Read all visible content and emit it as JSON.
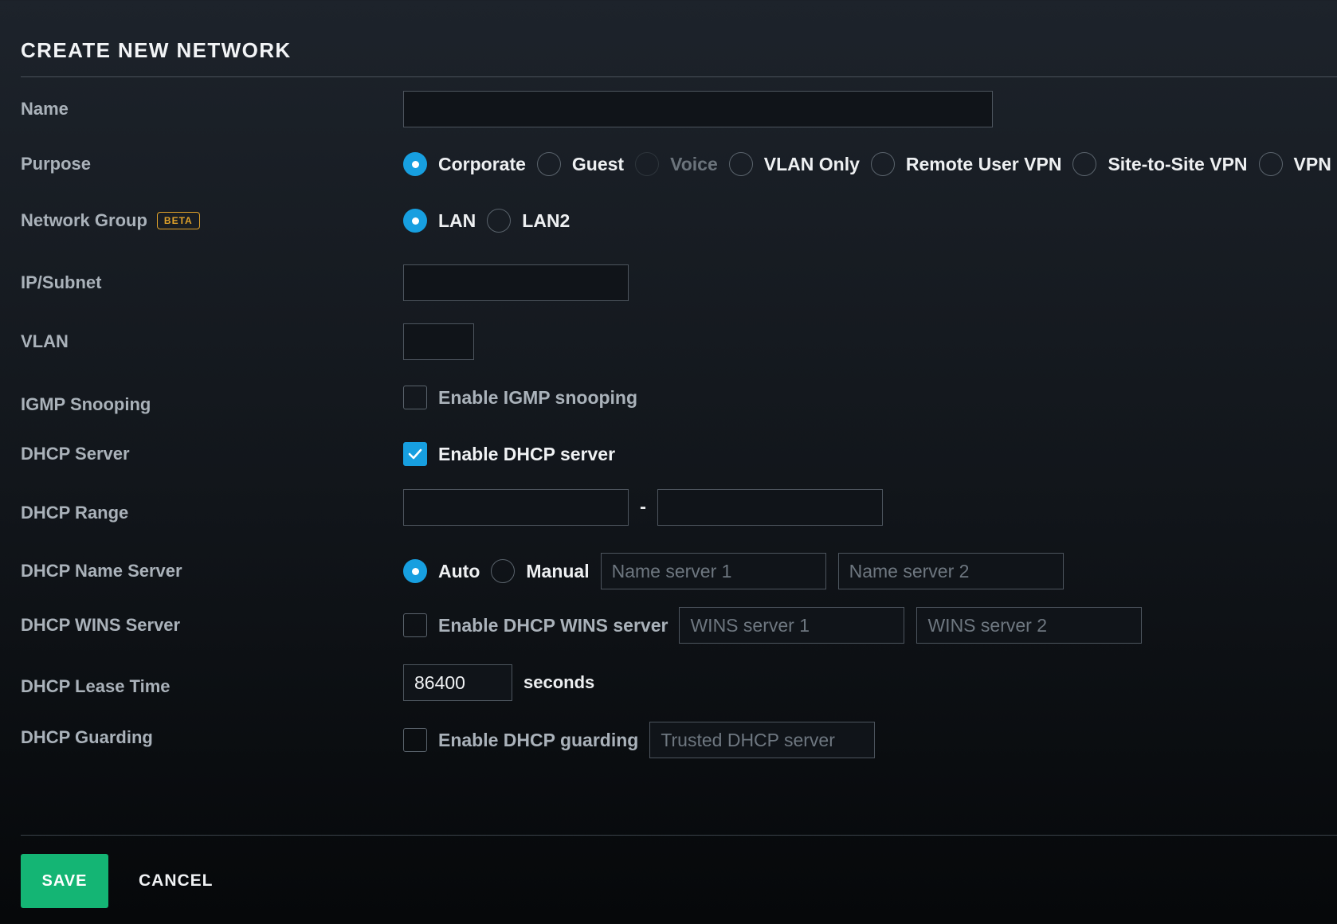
{
  "dialog": {
    "title": "CREATE NEW NETWORK"
  },
  "colors": {
    "accent_blue": "#179fe0",
    "save_green": "#14b574",
    "beta_orange": "#e0a22a"
  },
  "fields": {
    "name": {
      "label": "Name",
      "value": "",
      "placeholder": ""
    },
    "purpose": {
      "label": "Purpose",
      "options": [
        {
          "label": "Corporate",
          "selected": true,
          "disabled": false
        },
        {
          "label": "Guest",
          "selected": false,
          "disabled": false
        },
        {
          "label": "Voice",
          "selected": false,
          "disabled": true
        },
        {
          "label": "VLAN Only",
          "selected": false,
          "disabled": false
        },
        {
          "label": "Remote User VPN",
          "selected": false,
          "disabled": false
        },
        {
          "label": "Site-to-Site VPN",
          "selected": false,
          "disabled": false
        },
        {
          "label": "VPN Client",
          "selected": false,
          "disabled": false
        }
      ]
    },
    "network_group": {
      "label": "Network Group",
      "badge": "BETA",
      "options": [
        {
          "label": "LAN",
          "selected": true
        },
        {
          "label": "LAN2",
          "selected": false
        }
      ]
    },
    "ip_subnet": {
      "label": "IP/Subnet",
      "value": ""
    },
    "vlan": {
      "label": "VLAN",
      "value": ""
    },
    "igmp": {
      "label": "IGMP Snooping",
      "checkbox_label": "Enable IGMP snooping",
      "checked": false
    },
    "dhcp_server": {
      "label": "DHCP Server",
      "checkbox_label": "Enable DHCP server",
      "checked": true
    },
    "dhcp_range": {
      "label": "DHCP Range",
      "separator": "-",
      "start": "",
      "end": ""
    },
    "dhcp_name_server": {
      "label": "DHCP Name Server",
      "options": [
        {
          "label": "Auto",
          "selected": true
        },
        {
          "label": "Manual",
          "selected": false
        }
      ],
      "ns1_placeholder": "Name server 1",
      "ns2_placeholder": "Name server 2"
    },
    "dhcp_wins": {
      "label": "DHCP WINS Server",
      "checkbox_label": "Enable DHCP WINS server",
      "checked": false,
      "wins1_placeholder": "WINS server 1",
      "wins2_placeholder": "WINS server 2"
    },
    "dhcp_lease": {
      "label": "DHCP Lease Time",
      "value": "86400",
      "unit": "seconds"
    },
    "dhcp_guarding": {
      "label": "DHCP Guarding",
      "checkbox_label": "Enable DHCP guarding",
      "checked": false,
      "trusted_placeholder": "Trusted DHCP server"
    }
  },
  "footer": {
    "save_label": "SAVE",
    "cancel_label": "CANCEL"
  }
}
